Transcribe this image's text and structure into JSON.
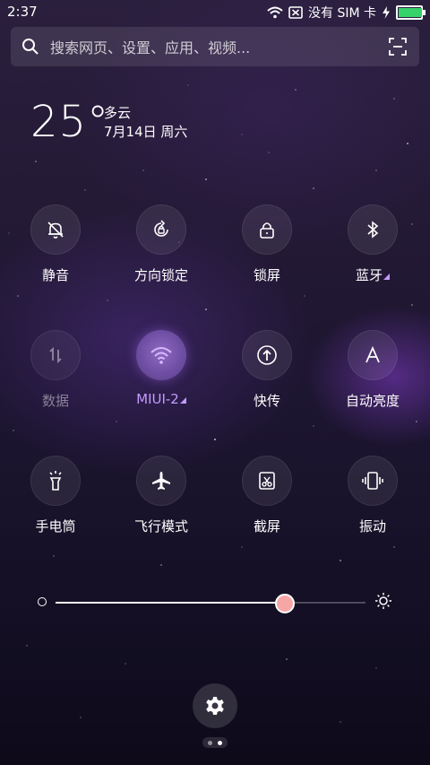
{
  "status_bar": {
    "time": "2:37",
    "sim_text": "没有 SIM 卡",
    "battery_level": 1.0,
    "icons": [
      "wifi-icon",
      "no-sim-icon",
      "charging-icon",
      "battery-icon"
    ]
  },
  "search": {
    "placeholder": "搜索网页、设置、应用、视频..."
  },
  "weather": {
    "temperature": "25°",
    "condition": "多云",
    "date": "7月14日 周六"
  },
  "toggles": [
    {
      "label": "静音",
      "icon": "bell-off-icon",
      "state": "off"
    },
    {
      "label": "方向锁定",
      "icon": "rotation-lock-icon",
      "state": "off"
    },
    {
      "label": "锁屏",
      "icon": "lock-icon",
      "state": "off"
    },
    {
      "label": "蓝牙",
      "icon": "bluetooth-icon",
      "state": "off",
      "has_more": true
    },
    {
      "label": "数据",
      "icon": "mobile-data-icon",
      "state": "disabled"
    },
    {
      "label": "MIUI-2",
      "icon": "wifi-icon",
      "state": "on",
      "has_more": true
    },
    {
      "label": "快传",
      "icon": "quick-transfer-icon",
      "state": "off"
    },
    {
      "label": "自动亮度",
      "icon": "auto-brightness-icon",
      "state": "off"
    },
    {
      "label": "手电筒",
      "icon": "flashlight-icon",
      "state": "off"
    },
    {
      "label": "飞行模式",
      "icon": "airplane-icon",
      "state": "off"
    },
    {
      "label": "截屏",
      "icon": "screenshot-icon",
      "state": "off"
    },
    {
      "label": "振动",
      "icon": "vibrate-icon",
      "state": "off"
    }
  ],
  "brightness": {
    "value": 0.74
  },
  "pager": {
    "pages": 2,
    "current": 2
  },
  "colors": {
    "accent": "#c49bff",
    "knob": "#f7a6a6",
    "battery": "#36d26a"
  }
}
